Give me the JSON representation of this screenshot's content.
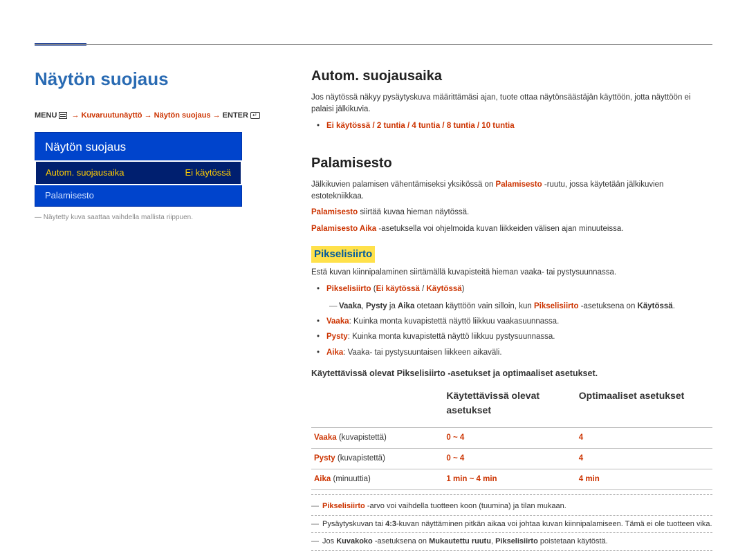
{
  "page_title": "Näytön suojaus",
  "breadcrumb": {
    "menu_label": "MENU",
    "arrow": "→",
    "part1": "Kuvaruutunäyttö",
    "part2": "Näytön suojaus",
    "enter_label": "ENTER"
  },
  "osd": {
    "title": "Näytön suojaus",
    "rows": [
      {
        "label": "Autom. suojausaika",
        "value": "Ei käytössä",
        "selected": true
      },
      {
        "label": "Palamisesto",
        "value": "",
        "selected": false
      }
    ]
  },
  "osd_footnote": "Näytetty kuva saattaa vaihdella mallista riippuen.",
  "section1": {
    "title": "Autom. suojausaika",
    "body": "Jos näytössä näkyy pysäytyskuva määrittämäsi ajan, tuote ottaa näytönsäästäjän käyttöön, jotta näyttöön ei palaisi jälkikuvia.",
    "bullet": "Ei käytössä / 2 tuntia / 4 tuntia / 8 tuntia / 10 tuntia"
  },
  "section2": {
    "title": "Palamisesto",
    "body_pre": "Jälkikuvien palamisen vähentämiseksi yksikössä on ",
    "body_mid": "Palamisesto",
    "body_post": " -ruutu, jossa käytetään jälkikuvien estotekniikkaa.",
    "line2_pre": "Palamisesto",
    "line2_post": " siirtää kuvaa hieman näytössä.",
    "line3_pre": "Palamisesto Aika",
    "line3_post": " -asetuksella voi ohjelmoida kuvan liikkeiden välisen ajan minuuteissa.",
    "sub_title": "Pikselisiirto",
    "sub_body": "Estä kuvan kiinnipalaminen siirtämällä kuvapisteitä hieman vaaka- tai pystysuunnassa.",
    "bullet1_parts": {
      "p1": "Pikselisiirto",
      "p2": "(",
      "p3": "Ei käytössä",
      "slash": " / ",
      "p4": "Käytössä",
      "p5": ")"
    },
    "note1_parts": {
      "a": "Vaaka",
      "comma1": ", ",
      "b": "Pysty",
      "and": " ja ",
      "c": "Aika",
      "mid": " otetaan käyttöön vain silloin, kun ",
      "d": "Pikselisiirto",
      "mid2": " -asetuksena on ",
      "e": "Käytössä",
      "end": "."
    },
    "bullet2_parts": {
      "label": "Vaaka",
      "text": ": Kuinka monta kuvapistettä näyttö liikkuu vaakasuunnassa."
    },
    "bullet3_parts": {
      "label": "Pysty",
      "text": ": Kuinka monta kuvapistettä näyttö liikkuu pystysuunnassa."
    },
    "bullet4_parts": {
      "label": "Aika",
      "text": ": Vaaka- tai pystysuuntaisen liikkeen aikaväli."
    },
    "table_title": "Käytettävissä olevat Pikselisiirto -asetukset ja optimaaliset asetukset.",
    "table": {
      "header1": "Käytettävissä olevat asetukset",
      "header2": "Optimaaliset asetukset",
      "rows": [
        {
          "label": "Vaaka",
          "unit": " (kuvapistettä)",
          "range": "0 ~ 4",
          "opt": "4"
        },
        {
          "label": "Pysty",
          "unit": " (kuvapistettä)",
          "range": "0 ~ 4",
          "opt": "4"
        },
        {
          "label": "Aika",
          "unit": " (minuuttia)",
          "range": "1 min ~ 4 min",
          "opt": "4 min"
        }
      ]
    },
    "notes": [
      {
        "pre": "",
        "red": "Pikselisiirto",
        "post": " -arvo voi vaihdella tuotteen koon (tuumina) ja tilan mukaan."
      },
      {
        "pre": "Pysäytyskuvan tai ",
        "bold1": "4:3",
        "mid": "-kuvan näyttäminen pitkän aikaa voi johtaa kuvan kiinnipalamiseen. Tämä ei ole tuotteen vika.",
        "red": "",
        "post": ""
      },
      {
        "pre": "Jos ",
        "bold1": "Kuvakoko",
        "mid": " -asetuksena on ",
        "bold2": "Mukautettu ruutu",
        "mid2": ", ",
        "bold3": "Pikselisiirto",
        "post": " poistetaan käytöstä."
      }
    ]
  }
}
